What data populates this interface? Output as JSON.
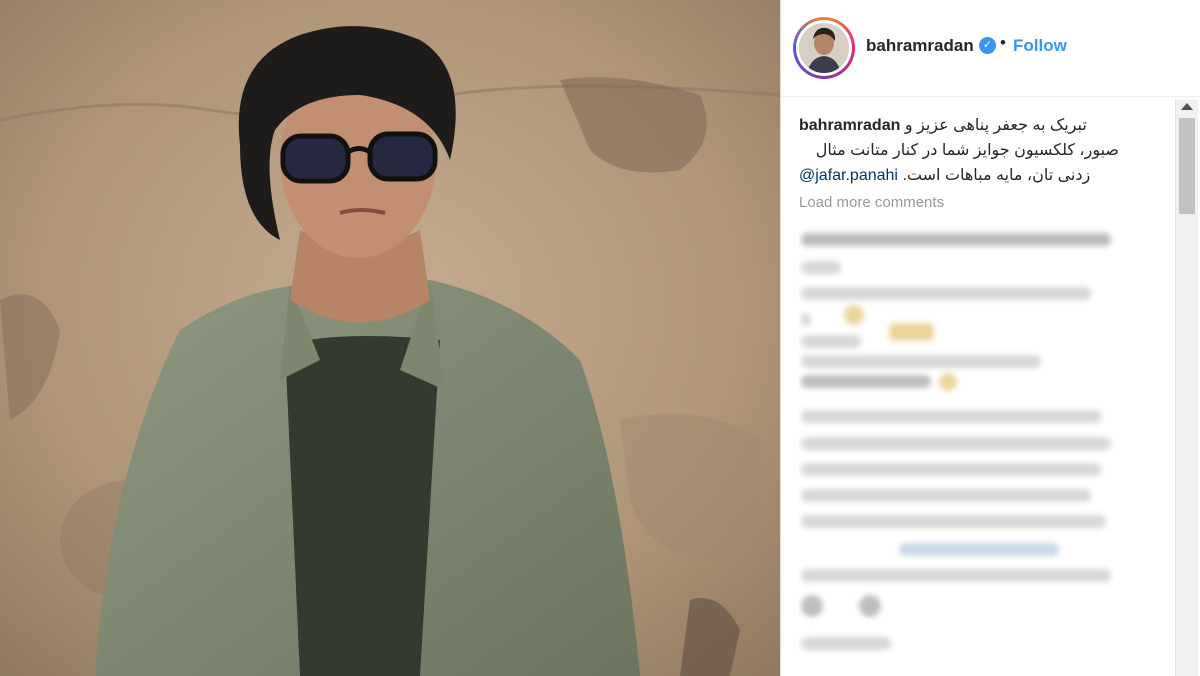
{
  "post": {
    "username": "bahramradan",
    "verified_badge": "verified-badge-icon",
    "separator": "•",
    "follow_label": "Follow"
  },
  "caption": {
    "username": "bahramradan",
    "line1": "تبریک به جعفر پناهی عزیز و",
    "line2": "صبور، کلکسیون جوایز شما در کنار متانت مثال",
    "line3": "زدنی تان، مایه مباهات است.",
    "mention": "@jafar.panahi"
  },
  "comments": {
    "load_more_label": "Load more comments"
  },
  "colors": {
    "accent": "#3897f0",
    "text": "#262626",
    "muted": "#999999",
    "mention": "#003569"
  }
}
